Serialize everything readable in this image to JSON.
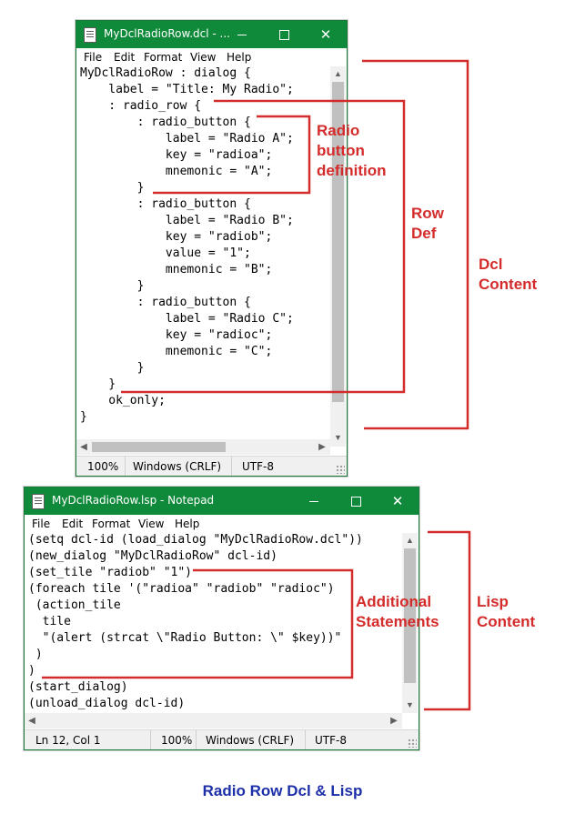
{
  "dcl_window": {
    "title": "MyDclRadioRow.dcl - ...",
    "menu": [
      "File",
      "Edit",
      "Format",
      "View",
      "Help"
    ],
    "lines": [
      "MyDclRadioRow : dialog {",
      "    label = \"Title: My Radio\";",
      "    : radio_row {",
      "        : radio_button {",
      "            label = \"Radio A\";",
      "            key = \"radioa\";",
      "            mnemonic = \"A\";",
      "        }",
      "        : radio_button {",
      "            label = \"Radio B\";",
      "            key = \"radiob\";",
      "            value = \"1\";",
      "            mnemonic = \"B\";",
      "        }",
      "        : radio_button {",
      "            label = \"Radio C\";",
      "            key = \"radioc\";",
      "            mnemonic = \"C\";",
      "        }",
      "    }",
      "    ok_only;",
      "}"
    ],
    "status": {
      "zoom": "100%",
      "line_ending": "Windows (CRLF)",
      "encoding": "UTF-8"
    }
  },
  "lsp_window": {
    "title": "MyDclRadioRow.lsp - Notepad",
    "menu": [
      "File",
      "Edit",
      "Format",
      "View",
      "Help"
    ],
    "lines": [
      "(setq dcl-id (load_dialog \"MyDclRadioRow.dcl\"))",
      "(new_dialog \"MyDclRadioRow\" dcl-id)",
      "(set_tile \"radiob\" \"1\")",
      "(foreach tile '(\"radioa\" \"radiob\" \"radioc\")",
      " (action_tile",
      "  tile",
      "  \"(alert (strcat \\\"Radio Button: \\\" $key))\"",
      " )",
      ")",
      "(start_dialog)",
      "(unload_dialog dcl-id)"
    ],
    "status": {
      "position": "Ln 12, Col 1",
      "zoom": "100%",
      "line_ending": "Windows (CRLF)",
      "encoding": "UTF-8"
    }
  },
  "annotations": {
    "radio_button_definition": [
      "Radio",
      "button",
      "definition"
    ],
    "row_def": [
      "Row",
      "Def"
    ],
    "dcl_content": [
      "Dcl",
      "Content"
    ],
    "additional_statements": [
      "Additional",
      "Statements"
    ],
    "lisp_content": [
      "Lisp",
      "Content"
    ]
  },
  "caption": "Radio Row Dcl & Lisp",
  "colors": {
    "titlebar": "#0f8a3a",
    "annotation": "#d42b2b",
    "caption": "#1c2fa8"
  }
}
